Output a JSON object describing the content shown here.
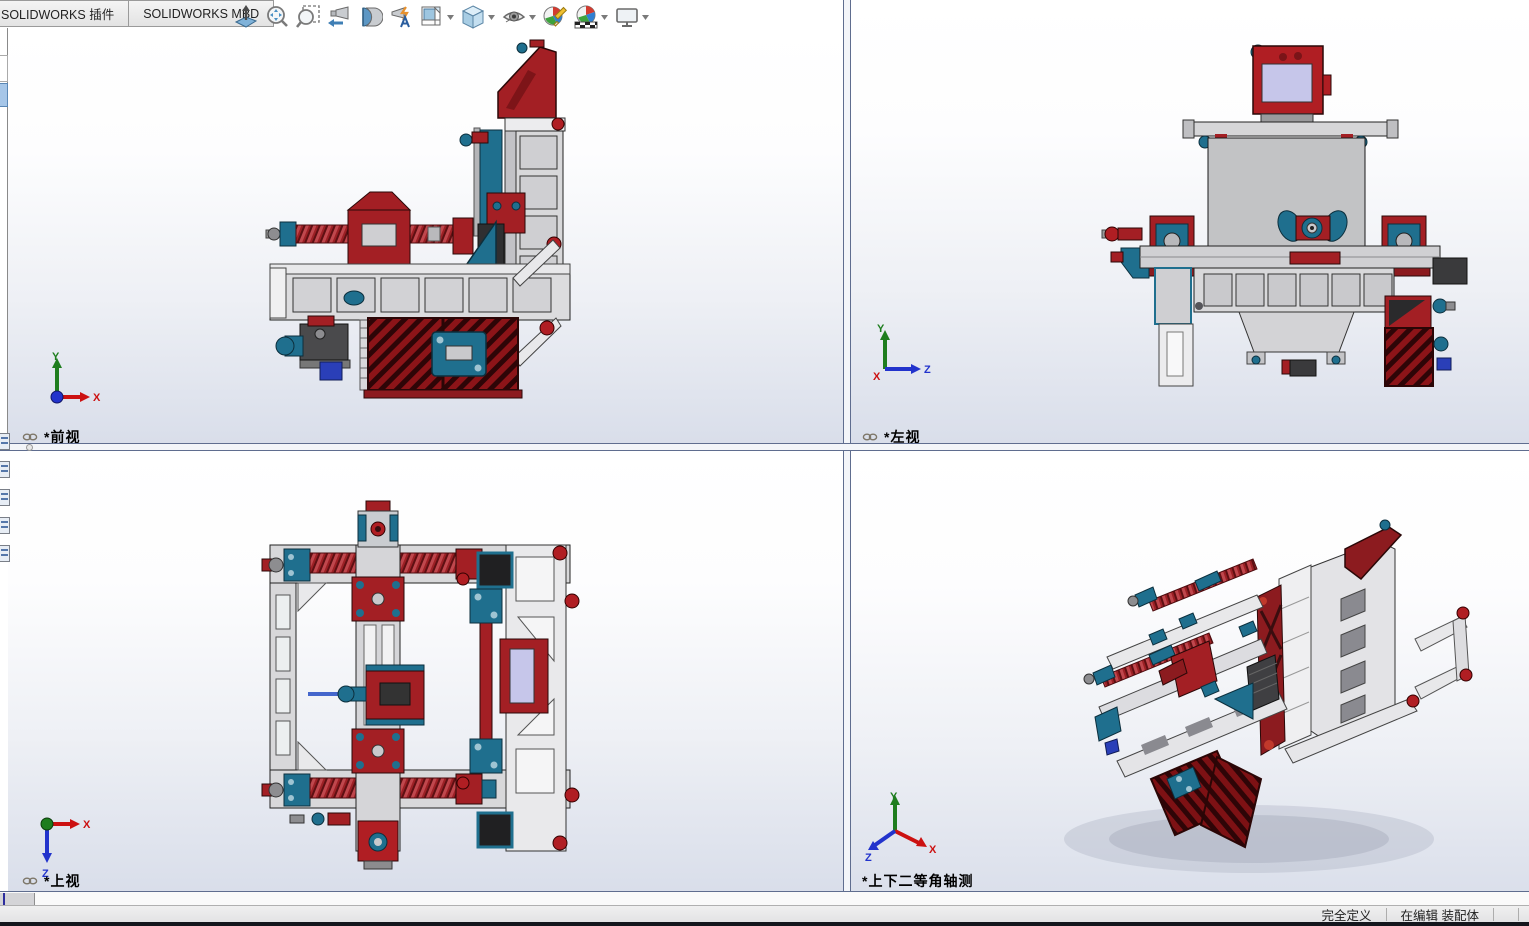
{
  "tabs": [
    {
      "label": "SOLIDWORKS 插件"
    },
    {
      "label": "SOLIDWORKS MBD"
    }
  ],
  "toolbar": {
    "items": [
      {
        "name": "normal-to",
        "dropdown": false
      },
      {
        "name": "zoom-to-fit",
        "dropdown": false
      },
      {
        "name": "zoom-to-area",
        "dropdown": false
      },
      {
        "name": "previous-view",
        "dropdown": false
      },
      {
        "name": "section-view",
        "dropdown": false
      },
      {
        "name": "dynamic-annotation-views",
        "dropdown": false
      },
      {
        "name": "view-orientation",
        "dropdown": true
      },
      {
        "name": "display-style",
        "dropdown": true
      },
      {
        "name": "hide-show-items",
        "dropdown": true
      },
      {
        "name": "edit-appearance",
        "dropdown": false
      },
      {
        "name": "apply-scene",
        "dropdown": true
      },
      {
        "name": "view-settings",
        "dropdown": true
      }
    ]
  },
  "viewports": [
    {
      "id": "front",
      "label": "*前视",
      "linked": true
    },
    {
      "id": "left",
      "label": "*左视",
      "linked": true
    },
    {
      "id": "top",
      "label": "*上视",
      "linked": true
    },
    {
      "id": "iso",
      "label": "*上下二等角轴测",
      "linked": false
    }
  ],
  "axis": {
    "x": "X",
    "y": "Y",
    "z": "Z"
  },
  "statusbar": {
    "fully_defined": "完全定义",
    "editing": "在编辑 装配体"
  },
  "colors": {
    "part_red": "#a31f24",
    "part_dark_red": "#8c1b1f",
    "steel_blue": "#1f6f8e",
    "frame_gray": "#d8d8da",
    "axis_x": "#cc1111",
    "axis_y": "#1e7d1e",
    "axis_z": "#2233cc"
  }
}
